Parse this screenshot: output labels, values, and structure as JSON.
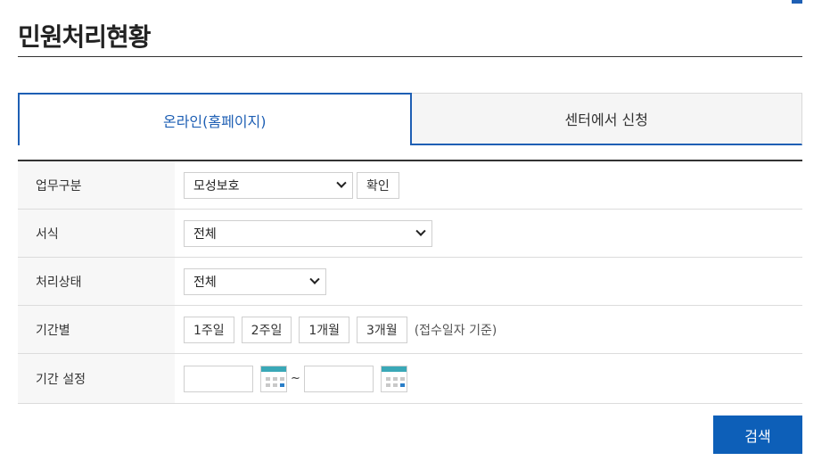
{
  "page": {
    "title": "민원처리현황"
  },
  "tabs": [
    {
      "label": "온라인(홈페이지)",
      "active": true
    },
    {
      "label": "센터에서 신청",
      "active": false
    }
  ],
  "form": {
    "work_type": {
      "label": "업무구분",
      "selected": "모성보호",
      "confirm_label": "확인"
    },
    "format": {
      "label": "서식",
      "selected": "전체"
    },
    "status": {
      "label": "처리상태",
      "selected": "전체"
    },
    "period": {
      "label": "기간별",
      "buttons": [
        "1주일",
        "2주일",
        "1개월",
        "3개월"
      ],
      "note": "(접수일자 기준)"
    },
    "period_setting": {
      "label": "기간 설정",
      "start_value": "",
      "separator": "~",
      "end_value": ""
    }
  },
  "actions": {
    "search_label": "검색"
  },
  "colors": {
    "accent": "#1e5fb4",
    "button": "#0d5fb8",
    "calendar_top": "#3aa8b7"
  }
}
